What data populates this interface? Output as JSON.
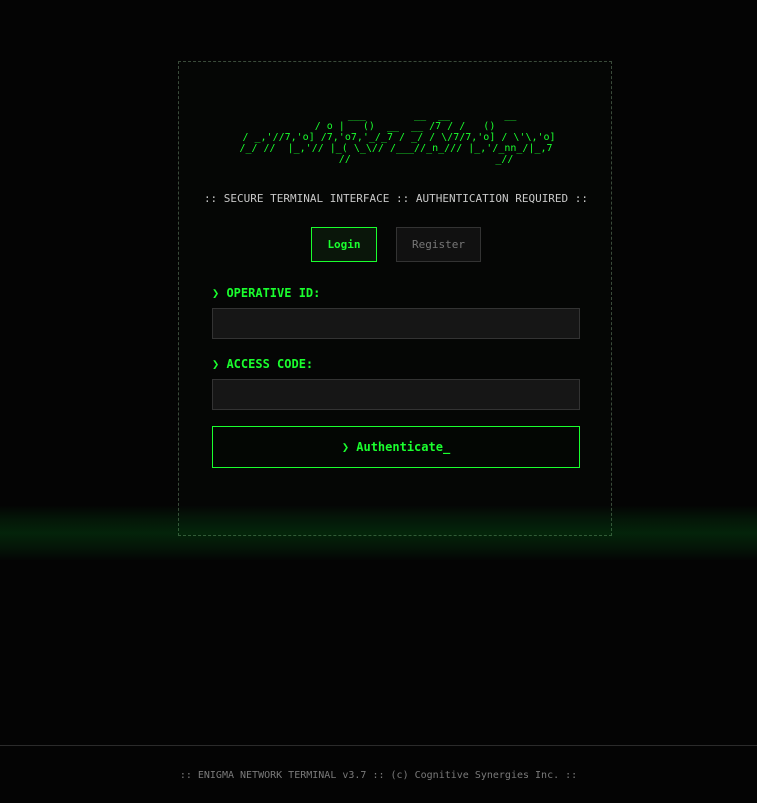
{
  "logo": {
    "ascii": "            ___        __  __         __\n   / o |   ()  __  __ /7 / /   ()\n / _,'//7,'o] /7,'o7,'_/_7 / _/ / \\/7/7,'o] / \\'\\,'o]\n/_/ //  |_,'// |_( \\_\\// /___//_n_/// |_,'/_nn_/|_,7\n          //                        _//"
  },
  "subtitle": ":: SECURE TERMINAL INTERFACE :: AUTHENTICATION REQUIRED ::",
  "tabs": {
    "login": "Login",
    "register": "Register"
  },
  "form": {
    "operative_id_label": "❯ OPERATIVE ID:",
    "operative_id_value": "",
    "access_code_label": "❯ ACCESS CODE:",
    "access_code_value": "",
    "submit_label": "❯ Authenticate_"
  },
  "footer": {
    "text": ":: ENIGMA NETWORK TERMINAL v3.7 :: (c) Cognitive Synergies Inc. ::"
  },
  "colors": {
    "accent": "#1aff2e",
    "background": "#040404",
    "panel_border": "#3a4a3a",
    "muted_text": "#7a7a7a"
  }
}
